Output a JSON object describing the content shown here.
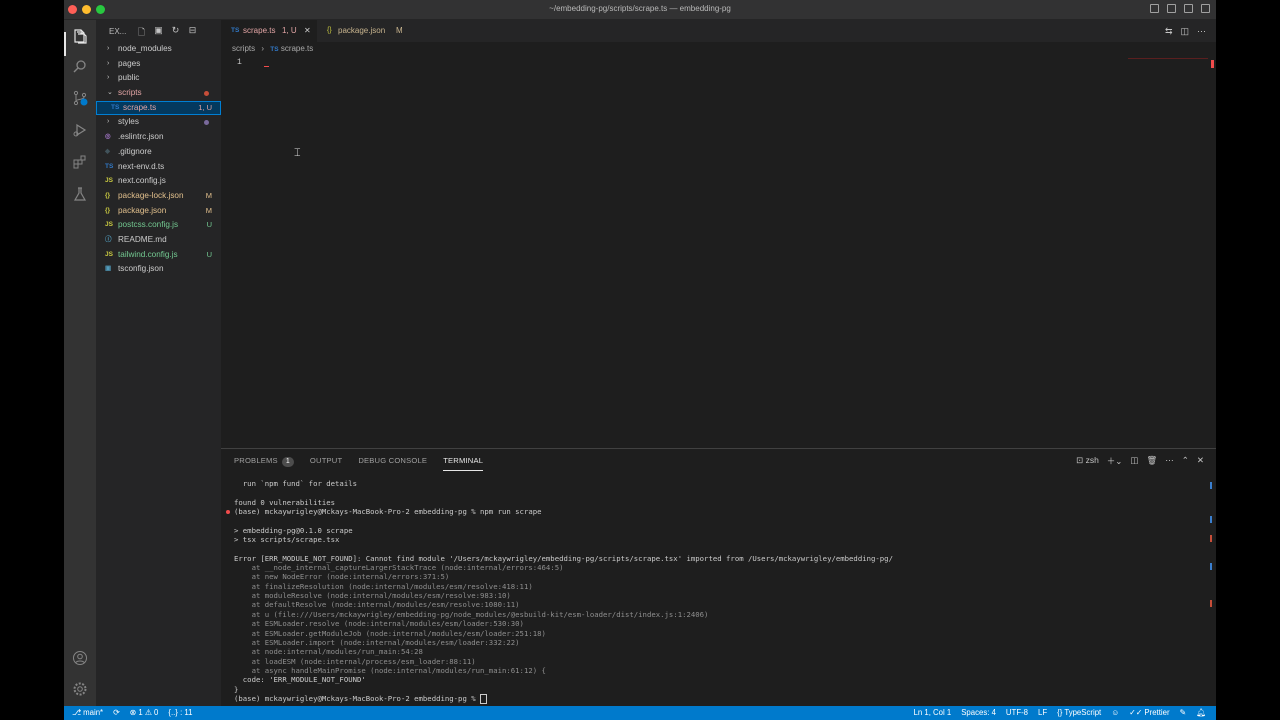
{
  "window": {
    "title": "~/embedding-pg/scripts/scrape.ts — embedding-pg"
  },
  "sidebar": {
    "title": "EX...",
    "items": [
      {
        "label": "node_modules",
        "kind": "folder",
        "status": ""
      },
      {
        "label": "pages",
        "kind": "folder",
        "status": ""
      },
      {
        "label": "public",
        "kind": "folder",
        "status": ""
      },
      {
        "label": "scripts",
        "kind": "folder-open",
        "status": ""
      },
      {
        "label": "scrape.ts",
        "kind": "ts",
        "status": "1, U"
      },
      {
        "label": "styles",
        "kind": "folder",
        "status": ""
      },
      {
        "label": ".eslintrc.json",
        "kind": "eslint",
        "status": ""
      },
      {
        "label": ".gitignore",
        "kind": "git",
        "status": ""
      },
      {
        "label": "next-env.d.ts",
        "kind": "ts",
        "status": ""
      },
      {
        "label": "next.config.js",
        "kind": "js",
        "status": ""
      },
      {
        "label": "package-lock.json",
        "kind": "json",
        "status": "M"
      },
      {
        "label": "package.json",
        "kind": "json",
        "status": "M"
      },
      {
        "label": "postcss.config.js",
        "kind": "js",
        "status": "U"
      },
      {
        "label": "README.md",
        "kind": "md",
        "status": ""
      },
      {
        "label": "tailwind.config.js",
        "kind": "js",
        "status": "U"
      },
      {
        "label": "tsconfig.json",
        "kind": "tsconfig",
        "status": ""
      }
    ]
  },
  "tabs": [
    {
      "icon": "TS",
      "label": "scrape.ts",
      "status": "1, U"
    },
    {
      "icon": "{}",
      "label": "package.json",
      "status": "M"
    }
  ],
  "breadcrumb": {
    "folder": "scripts",
    "icon": "TS",
    "file": "scrape.ts"
  },
  "editor": {
    "line_number": "1"
  },
  "panel": {
    "tabs": [
      {
        "label": "PROBLEMS",
        "badge": "1"
      },
      {
        "label": "OUTPUT"
      },
      {
        "label": "DEBUG CONSOLE"
      },
      {
        "label": "TERMINAL"
      }
    ],
    "shell": "zsh",
    "terminal_lines": [
      "  run `npm fund` for details",
      "",
      "found 0 vulnerabilities",
      "(base) mckaywrigley@Mckays-MacBook-Pro-2 embedding-pg % npm run scrape",
      "",
      "> embedding-pg@0.1.0 scrape",
      "> tsx scripts/scrape.tsx",
      "",
      "Error [ERR_MODULE_NOT_FOUND]: Cannot find module '/Users/mckaywrigley/embedding-pg/scripts/scrape.tsx' imported from /Users/mckaywrigley/embedding-pg/",
      "    at __node_internal_captureLargerStackTrace (node:internal/errors:464:5)",
      "    at new NodeError (node:internal/errors:371:5)",
      "    at finalizeResolution (node:internal/modules/esm/resolve:418:11)",
      "    at moduleResolve (node:internal/modules/esm/resolve:983:10)",
      "    at defaultResolve (node:internal/modules/esm/resolve:1080:11)",
      "    at u (file:///Users/mckaywrigley/embedding-pg/node_modules/@esbuild-kit/esm-loader/dist/index.js:1:2406)",
      "    at ESMLoader.resolve (node:internal/modules/esm/loader:530:30)",
      "    at ESMLoader.getModuleJob (node:internal/modules/esm/loader:251:18)",
      "    at ESMLoader.import (node:internal/modules/esm/loader:332:22)",
      "    at node:internal/modules/run_main:54:28",
      "    at loadESM (node:internal/process/esm_loader:88:11)",
      "    at async handleMainPromise (node:internal/modules/run_main:61:12) {",
      "  code: 'ERR_MODULE_NOT_FOUND'",
      "}",
      "(base) mckaywrigley@Mckays-MacBook-Pro-2 embedding-pg % "
    ]
  },
  "status": {
    "branch": "main*",
    "errors": "1",
    "warnings": "0",
    "braces": "{..} : 11",
    "position": "Ln 1, Col 1",
    "spaces": "Spaces: 4",
    "encoding": "UTF-8",
    "eol": "LF",
    "language": "TypeScript",
    "formatter": "Prettier"
  },
  "colors": {
    "accent": "#007acc",
    "error": "#f14c4c",
    "modified": "#e2c08d",
    "untracked": "#73c991",
    "ts": "#3178c6",
    "js": "#cbcb41",
    "json": "#cbcb41"
  }
}
